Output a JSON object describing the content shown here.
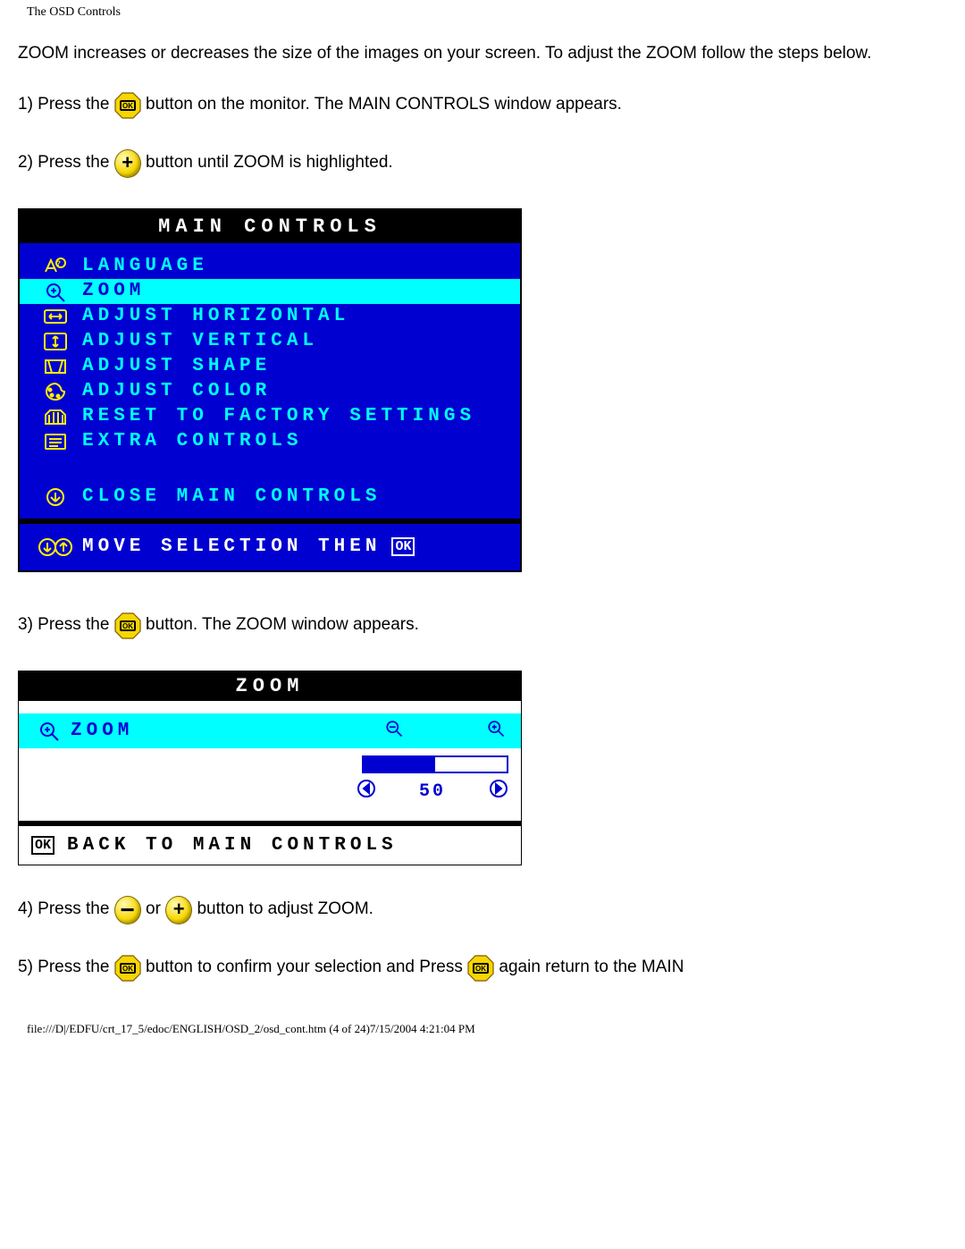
{
  "page_title": "The OSD Controls",
  "intro": "ZOOM increases or decreases the size of the images on your screen. To adjust the ZOOM follow the steps below.",
  "steps": {
    "s1a": "1) Press the ",
    "s1b": " button on the monitor. The MAIN CONTROLS window appears.",
    "s2a": "2) Press the ",
    "s2b": " button until ZOOM is highlighted.",
    "s3a": "3) Press the ",
    "s3b": " button. The ZOOM window appears.",
    "s4a": "4) Press the ",
    "s4or": " or ",
    "s4b": " button to adjust ZOOM.",
    "s5a": "5) Press the ",
    "s5b": " button to confirm your selection and Press ",
    "s5c": " again return to the MAIN"
  },
  "osd": {
    "title": "MAIN CONTROLS",
    "items": [
      {
        "label": "LANGUAGE",
        "icon": "language-icon"
      },
      {
        "label": "ZOOM",
        "icon": "zoom-in-icon",
        "highlight": true
      },
      {
        "label": "ADJUST HORIZONTAL",
        "icon": "adjust-horizontal-icon"
      },
      {
        "label": "ADJUST VERTICAL",
        "icon": "adjust-vertical-icon"
      },
      {
        "label": "ADJUST SHAPE",
        "icon": "adjust-shape-icon"
      },
      {
        "label": "ADJUST COLOR",
        "icon": "adjust-color-icon"
      },
      {
        "label": "RESET TO FACTORY SETTINGS",
        "icon": "factory-reset-icon"
      },
      {
        "label": "EXTRA CONTROLS",
        "icon": "extra-controls-icon"
      }
    ],
    "close_label": "CLOSE MAIN CONTROLS",
    "footer_label": "MOVE SELECTION THEN",
    "footer_ok": "OK"
  },
  "zoom": {
    "title": "ZOOM",
    "item_label": "ZOOM",
    "value": 50,
    "back_label": "BACK TO MAIN CONTROLS",
    "back_ok": "OK"
  },
  "footer_path": "file:///D|/EDFU/crt_17_5/edoc/ENGLISH/OSD_2/osd_cont.htm (4 of 24)7/15/2004 4:21:04 PM"
}
